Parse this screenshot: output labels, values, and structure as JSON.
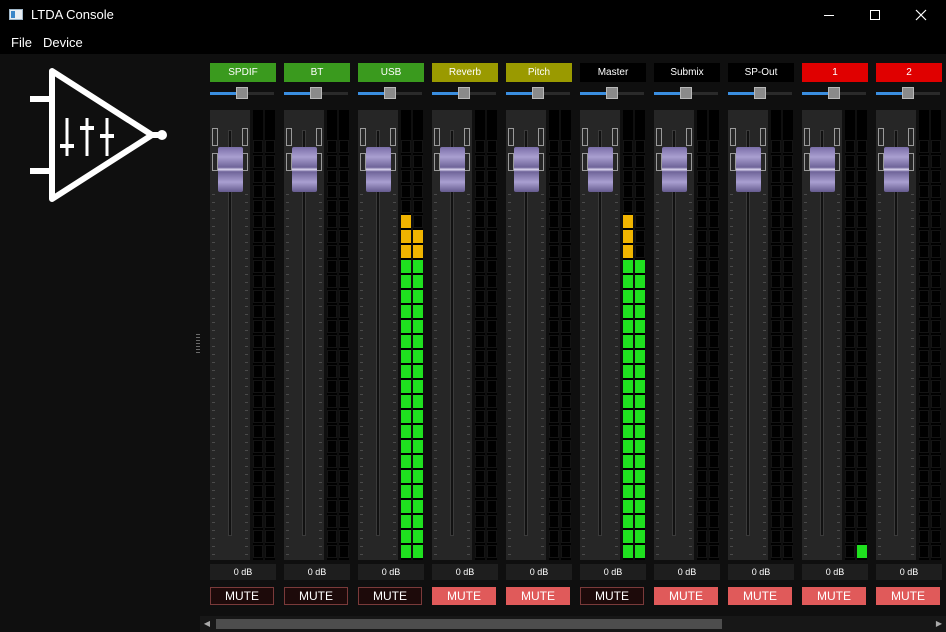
{
  "window": {
    "title": "LTDA Console"
  },
  "menu": [
    "File",
    "Device"
  ],
  "logo_icon": "mixer-amplifier-logo",
  "channels": [
    {
      "name": "SPDIF",
      "color": "#3a9a1e",
      "pan": 0.5,
      "gain": "0 dB",
      "mute": "MUTE",
      "muted": false,
      "meter": [
        0,
        0
      ]
    },
    {
      "name": "BT",
      "color": "#3a9a1e",
      "pan": 0.5,
      "gain": "0 dB",
      "mute": "MUTE",
      "muted": false,
      "meter": [
        0,
        0
      ]
    },
    {
      "name": "USB",
      "color": "#3a9a1e",
      "pan": 0.5,
      "gain": "0 dB",
      "mute": "MUTE",
      "muted": false,
      "meter": [
        0.82,
        0.79
      ]
    },
    {
      "name": "Reverb",
      "color": "#9a9a00",
      "pan": 0.5,
      "gain": "0 dB",
      "mute": "MUTE",
      "muted": true,
      "meter": [
        0,
        0
      ]
    },
    {
      "name": "Pitch",
      "color": "#9a9a00",
      "pan": 0.5,
      "gain": "0 dB",
      "mute": "MUTE",
      "muted": true,
      "meter": [
        0,
        0
      ]
    },
    {
      "name": "Master",
      "color": "#000000",
      "pan": 0.5,
      "gain": "0 dB",
      "mute": "MUTE",
      "muted": false,
      "meter": [
        0.82,
        0.72
      ]
    },
    {
      "name": "Submix",
      "color": "#000000",
      "pan": 0.5,
      "gain": "0 dB",
      "mute": "MUTE",
      "muted": true,
      "meter": [
        0,
        0
      ]
    },
    {
      "name": "SP-Out",
      "color": "#000000",
      "pan": 0.5,
      "gain": "0 dB",
      "mute": "MUTE",
      "muted": true,
      "meter": [
        0,
        0
      ]
    },
    {
      "name": "1",
      "color": "#e00000",
      "pan": 0.5,
      "gain": "0 dB",
      "mute": "MUTE",
      "muted": true,
      "meter": [
        0,
        0.03
      ]
    },
    {
      "name": "2",
      "color": "#e00000",
      "pan": 0.5,
      "gain": "0 dB",
      "mute": "MUTE",
      "muted": true,
      "meter": [
        0,
        0
      ]
    }
  ],
  "meter_colors": {
    "low": "#1fe01f",
    "high": "#f0b400",
    "off": "#141414"
  }
}
